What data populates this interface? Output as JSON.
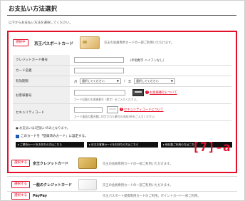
{
  "page": {
    "title": "お支払い方法選択",
    "lead": "以下からお支払い方法を選択してください。"
  },
  "selected": {
    "badge": "選択中",
    "card_title": "京王パスポートカード",
    "note": "京王の会員専用カードの一部ご利用いただけます。",
    "fields": {
      "card_number": {
        "label": "クレジットカード番号",
        "hint": "（半角数字 ハイフンなし）"
      },
      "card_holder": {
        "label": "カード名義"
      },
      "expiry": {
        "label": "有効期限",
        "month_prefix": "月",
        "month_value": "選択してください",
        "separator": "/",
        "year_prefix": "年",
        "year_value": "選択してください"
      },
      "member_no": {
        "label": "お客様番号",
        "link": "お客様番号について",
        "note": "カード記載のお客様番号（数字）をご入力ください。"
      },
      "security_code": {
        "label": "セキュリティコード",
        "link": "セキュリティコードについて",
        "note": "カード裏面の署名欄に印字された番号の末尾3桁をご入力ください。"
      }
    },
    "notice": "お支払いは1回払いのみとなります。",
    "checkbox_label": "このカードを「登録済みカード」に設定する。",
    "buttons": [
      "ご優待カードをお持ちの方はこちら",
      "京王お客様カードをお持ちの方はこちら",
      "他社製ご利用の方はこちら"
    ]
  },
  "annotation_tag": "[7]-a",
  "others": [
    {
      "badge": "選択する",
      "title": "京王クレジットカード",
      "note": "京王の会員専用カードの一部ご利用いただけます。"
    },
    {
      "badge": "選択する",
      "title": "一般のクレジットカード",
      "note": "京王の会員専用カードの一部ご利用いただけます。"
    },
    {
      "badge": "選択する",
      "title": "PayPay",
      "note": "京王パスポート提携専用カードのご利用。ポイントカード一部ご利用、"
    }
  ],
  "colors": {
    "accent": "#e3102a",
    "label_bg": "#efefef",
    "button_bg": "#111111"
  }
}
